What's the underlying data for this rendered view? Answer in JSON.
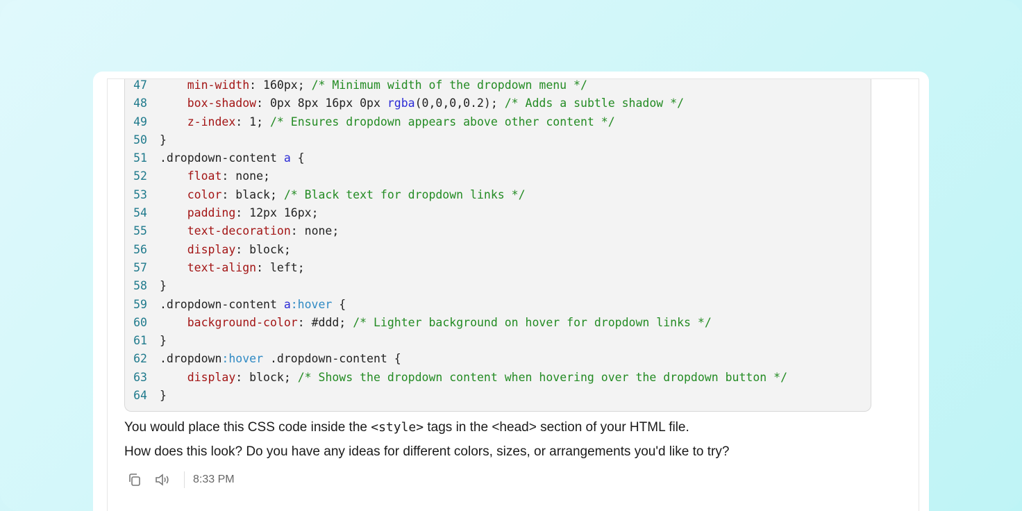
{
  "code": {
    "lines": [
      {
        "n": "47",
        "parts": [
          {
            "t": "    "
          },
          {
            "t": "min-width",
            "c": "prop"
          },
          {
            "t": ": 160px; "
          },
          {
            "t": "/* Minimum width of the dropdown menu */",
            "c": "cmt"
          }
        ]
      },
      {
        "n": "48",
        "parts": [
          {
            "t": "    "
          },
          {
            "t": "box-shadow",
            "c": "prop"
          },
          {
            "t": ": 0px 8px 16px 0px "
          },
          {
            "t": "rgba",
            "c": "kw"
          },
          {
            "t": "(0,0,0,0.2); "
          },
          {
            "t": "/* Adds a subtle shadow */",
            "c": "cmt"
          }
        ]
      },
      {
        "n": "49",
        "parts": [
          {
            "t": "    "
          },
          {
            "t": "z-index",
            "c": "prop"
          },
          {
            "t": ": 1; "
          },
          {
            "t": "/* Ensures dropdown appears above other content */",
            "c": "cmt"
          }
        ]
      },
      {
        "n": "50",
        "parts": [
          {
            "t": "}"
          }
        ]
      },
      {
        "n": "51",
        "parts": [
          {
            "t": ".dropdown-content "
          },
          {
            "t": "a",
            "c": "kw"
          },
          {
            "t": " {"
          }
        ]
      },
      {
        "n": "52",
        "parts": [
          {
            "t": "    "
          },
          {
            "t": "float",
            "c": "prop"
          },
          {
            "t": ": none;"
          }
        ]
      },
      {
        "n": "53",
        "parts": [
          {
            "t": "    "
          },
          {
            "t": "color",
            "c": "prop"
          },
          {
            "t": ": black; "
          },
          {
            "t": "/* Black text for dropdown links */",
            "c": "cmt"
          }
        ]
      },
      {
        "n": "54",
        "parts": [
          {
            "t": "    "
          },
          {
            "t": "padding",
            "c": "prop"
          },
          {
            "t": ": 12px 16px;"
          }
        ]
      },
      {
        "n": "55",
        "parts": [
          {
            "t": "    "
          },
          {
            "t": "text-decoration",
            "c": "prop"
          },
          {
            "t": ": none;"
          }
        ]
      },
      {
        "n": "56",
        "parts": [
          {
            "t": "    "
          },
          {
            "t": "display",
            "c": "prop"
          },
          {
            "t": ": block;"
          }
        ]
      },
      {
        "n": "57",
        "parts": [
          {
            "t": "    "
          },
          {
            "t": "text-align",
            "c": "prop"
          },
          {
            "t": ": left;"
          }
        ]
      },
      {
        "n": "58",
        "parts": [
          {
            "t": "}"
          }
        ]
      },
      {
        "n": "59",
        "parts": [
          {
            "t": ".dropdown-content "
          },
          {
            "t": "a",
            "c": "kw"
          },
          {
            "t": ":hover",
            "c": "pse"
          },
          {
            "t": " {"
          }
        ]
      },
      {
        "n": "60",
        "parts": [
          {
            "t": "    "
          },
          {
            "t": "background-color",
            "c": "prop"
          },
          {
            "t": ": #ddd; "
          },
          {
            "t": "/* Lighter background on hover for dropdown links */",
            "c": "cmt"
          }
        ]
      },
      {
        "n": "61",
        "parts": [
          {
            "t": "}"
          }
        ]
      },
      {
        "n": "62",
        "parts": [
          {
            "t": ".dropdown"
          },
          {
            "t": ":hover",
            "c": "pse"
          },
          {
            "t": " .dropdown-content {"
          }
        ]
      },
      {
        "n": "63",
        "parts": [
          {
            "t": "    "
          },
          {
            "t": "display",
            "c": "prop"
          },
          {
            "t": ": block; "
          },
          {
            "t": "/* Shows the dropdown content when hovering over the dropdown button */",
            "c": "cmt"
          }
        ]
      },
      {
        "n": "64",
        "parts": [
          {
            "t": "}"
          }
        ]
      }
    ]
  },
  "message": {
    "line1_before": "You would place this CSS code inside the ",
    "line1_tag1": "<style>",
    "line1_middle": " tags in the <head> section of your HTML file.",
    "line2": "How does this look? Do you have any ideas for different colors, sizes, or arrangements you'd like to try?"
  },
  "actions": {
    "copy_icon": "copy-icon",
    "speaker_icon": "speaker-icon",
    "time": "8:33 PM"
  }
}
